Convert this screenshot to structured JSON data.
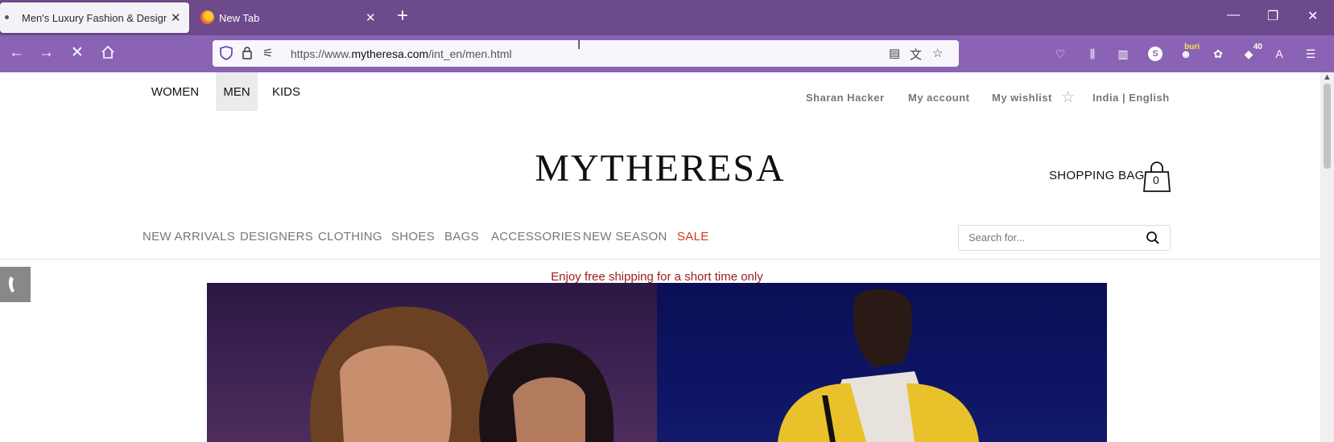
{
  "browser": {
    "tabs": [
      {
        "title": "Men's Luxury Fashion & Designer"
      },
      {
        "title": "New Tab"
      }
    ],
    "url_prefix": "https://www.",
    "url_domain": "mytheresa.com",
    "url_path": "/int_en/men.html",
    "extension_badges": {
      "buri": "buri",
      "count": "40"
    }
  },
  "site": {
    "genders": [
      "WOMEN",
      "MEN",
      "KIDS"
    ],
    "active_gender": "MEN",
    "user_links": {
      "name": "Sharan Hacker",
      "account": "My account",
      "wishlist": "My wishlist",
      "locale": "India | English"
    },
    "logo": "MYTHERESA",
    "shopping_bag": {
      "label": "SHOPPING BAG",
      "count": "0"
    },
    "menu": [
      "NEW ARRIVALS",
      "DESIGNERS",
      "CLOTHING",
      "SHOES",
      "BAGS",
      "ACCESSORIES",
      "NEW SEASON",
      "SALE"
    ],
    "search": {
      "placeholder": "Search for..."
    },
    "promo": "Enjoy free shipping for a short time only"
  },
  "colors": {
    "tabbar": "#6c4a8c",
    "navbar": "#8b63b5",
    "sale": "#d0361c",
    "promo": "#9c1b1b"
  }
}
